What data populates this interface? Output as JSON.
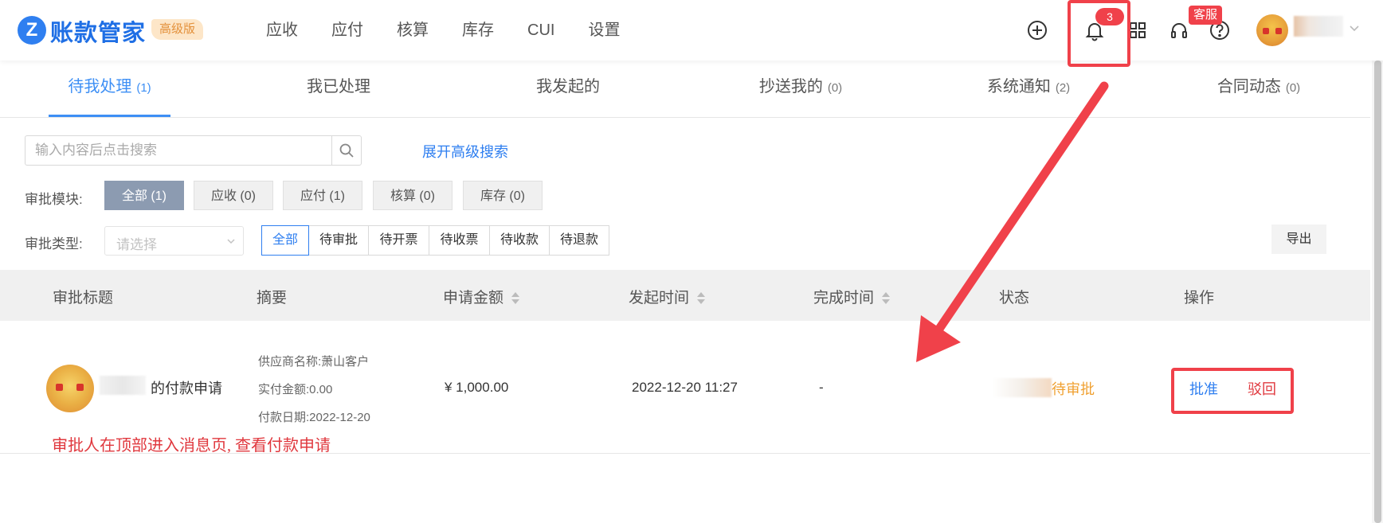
{
  "brand": {
    "logo_letter": "Z",
    "name": "账款管家",
    "edition": "高级版"
  },
  "nav": [
    "应收",
    "应付",
    "核算",
    "库存",
    "CUI",
    "设置"
  ],
  "header": {
    "notification_count": "3",
    "service_badge": "客服",
    "icons": [
      "plus-circle-icon",
      "bell-icon",
      "apps-grid-icon",
      "headset-icon",
      "help-circle-icon"
    ]
  },
  "tabs": [
    {
      "label": "待我处理",
      "count": "(1)"
    },
    {
      "label": "我已处理",
      "count": ""
    },
    {
      "label": "我发起的",
      "count": ""
    },
    {
      "label": "抄送我的",
      "count": "(0)"
    },
    {
      "label": "系统通知",
      "count": "(2)"
    },
    {
      "label": "合同动态",
      "count": "(0)"
    }
  ],
  "search": {
    "placeholder": "输入内容后点击搜索",
    "advanced_link": "展开高级搜索"
  },
  "filters": {
    "module_label": "审批模块:",
    "modules": [
      "全部 (1)",
      "应收 (0)",
      "应付 (1)",
      "核算 (0)",
      "库存 (0)"
    ],
    "type_label": "审批类型:",
    "type_placeholder": "请选择",
    "statuses": [
      "全部",
      "待审批",
      "待开票",
      "待收票",
      "待收款",
      "待退款"
    ],
    "export": "导出"
  },
  "table": {
    "columns": [
      "审批标题",
      "摘要",
      "申请金额",
      "发起时间",
      "完成时间",
      "状态",
      "操作"
    ],
    "rows": [
      {
        "title": "的付款申请",
        "summary": [
          "供应商名称:萧山客户",
          "实付金额:0.00",
          "付款日期:2022-12-20"
        ],
        "amount": "¥ 1,000.00",
        "start_time": "2022-12-20 11:27",
        "finish_time": "-",
        "status": "待审批",
        "actions": [
          "批准",
          "驳回"
        ]
      }
    ]
  },
  "annotation": "审批人在顶部进入消息页, 查看付款申请",
  "colors": {
    "brand_blue": "#1f6fe5",
    "accent_blue": "#3d8ff5",
    "highlight_red": "#f0414a",
    "status_orange": "#f0a030",
    "reject_red": "#e0383e"
  }
}
